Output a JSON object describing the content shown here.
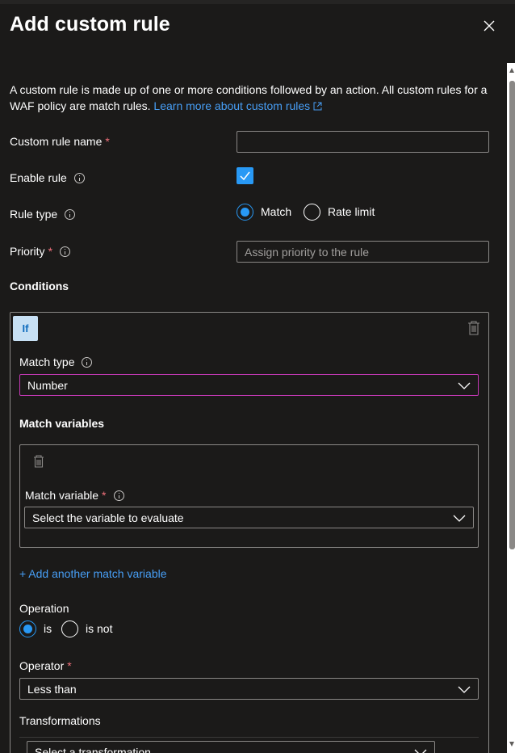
{
  "title": "Add custom rule",
  "description": {
    "text": "A custom rule is made up of one or more conditions followed by an action. All custom rules for a WAF policy are match rules.",
    "link": "Learn more about custom rules"
  },
  "fields": {
    "rule_name": {
      "label": "Custom rule name",
      "required": "*",
      "value": ""
    },
    "enable_rule": {
      "label": "Enable rule",
      "checked": true
    },
    "rule_type": {
      "label": "Rule type",
      "options": [
        "Match",
        "Rate limit"
      ],
      "selected": "Match"
    },
    "priority": {
      "label": "Priority",
      "required": "*",
      "placeholder": "Assign priority to the rule"
    }
  },
  "conditions": {
    "heading": "Conditions",
    "if_label": "If",
    "match_type": {
      "label": "Match type",
      "value": "Number"
    },
    "match_variables_heading": "Match variables",
    "match_variable": {
      "label": "Match variable",
      "required": "*",
      "placeholder": "Select the variable to evaluate"
    },
    "add_variable_link": "+ Add another match variable",
    "operation": {
      "label": "Operation",
      "options": [
        "is",
        "is not"
      ],
      "selected": "is"
    },
    "operator": {
      "label": "Operator",
      "required": "*",
      "value": "Less than"
    },
    "transformations": {
      "label": "Transformations",
      "placeholder": "Select a transformation"
    }
  },
  "colors": {
    "background": "#1b1a19",
    "accent": "#2899f5",
    "link": "#479ef5",
    "required": "#f1707b",
    "focus_border": "#c239b3"
  }
}
